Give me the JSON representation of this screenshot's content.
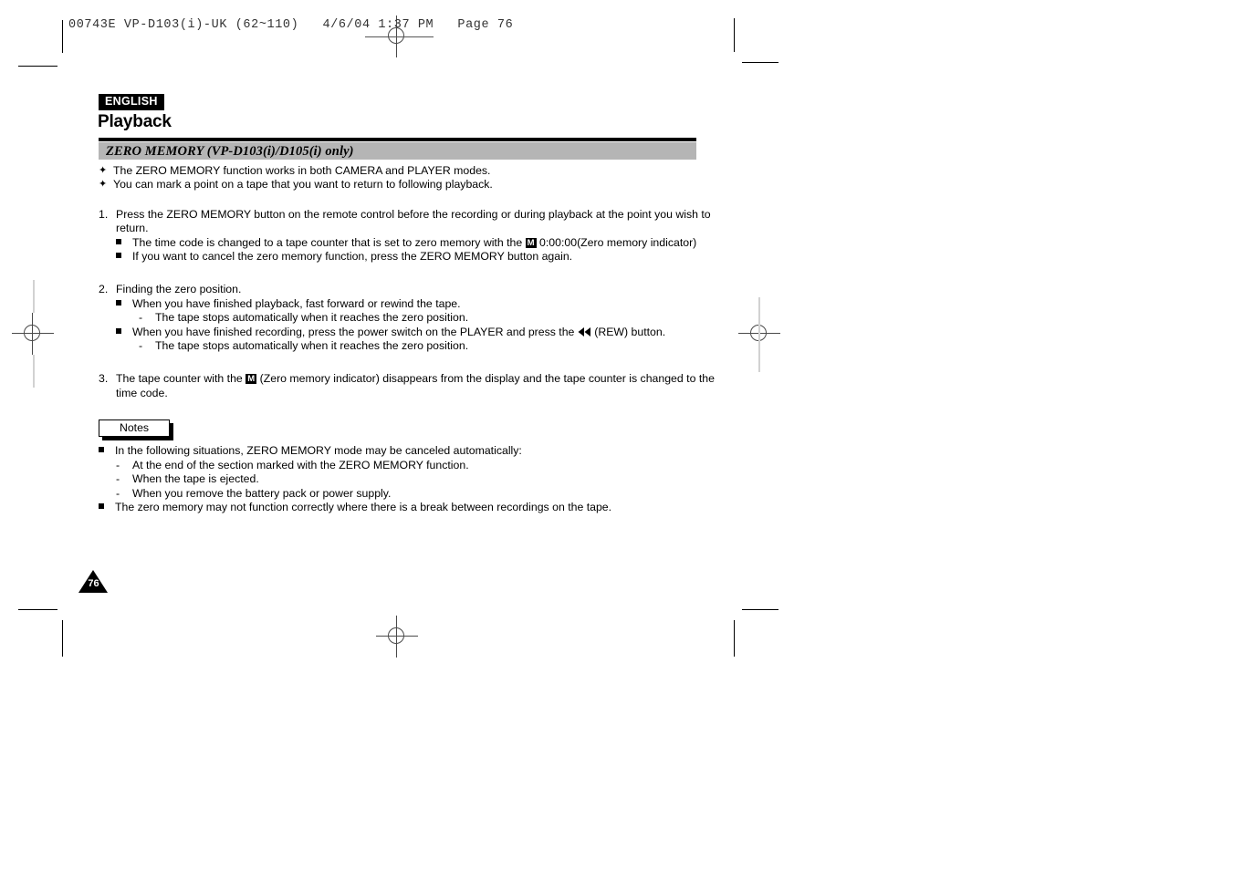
{
  "print_slug": {
    "text": "00743E VP-D103(i)-UK (62~110)   4/6/04 1:37 PM   Page 76"
  },
  "header": {
    "language_badge": "ENGLISH",
    "chapter_title": "Playback",
    "section_title": "ZERO MEMORY (VP-D103(i)/D105(i) only)"
  },
  "intro_bullets": [
    {
      "marker": "✦",
      "text": "The ZERO MEMORY function works in both CAMERA and PLAYER modes."
    },
    {
      "marker": "✦",
      "text": "You can mark a point on a tape that you want to return to following playback."
    }
  ],
  "steps": {
    "step1": {
      "number": "1.",
      "text": "Press the ZERO MEMORY button on the remote control before the recording or during playback at the point you wish to return.",
      "sub": [
        {
          "text_before": "The time code is changed to a tape counter that is set to zero memory with the",
          "icon": "M",
          "text_after": "0:00:00(Zero memory indicator)"
        },
        {
          "text_before": "If you want to cancel the zero memory function, press the ZERO MEMORY button again.",
          "icon": "",
          "text_after": ""
        }
      ]
    },
    "step2": {
      "number": "2.",
      "text": "Finding the zero position.",
      "sub1": "When you have finished playback, fast forward or rewind the tape.",
      "sub1_dash": "The tape stops automatically when it reaches the zero position.",
      "sub2_before": "When you have finished recording, press the power switch on the PLAYER and press the",
      "sub2_icon": "rewind-icon",
      "sub2_after": "(REW) button.",
      "sub2_dash": "The tape stops automatically when it reaches the zero position."
    },
    "step3": {
      "number": "3.",
      "text_before": "The tape counter with the",
      "icon": "M",
      "text_after": "(Zero memory indicator) disappears from the display and the tape counter is changed to the time code."
    }
  },
  "notes": {
    "label": "Notes",
    "items": [
      {
        "type": "square",
        "text": "In the following situations, ZERO MEMORY mode may be canceled automatically:"
      },
      {
        "type": "dash",
        "text": "At the end of the section marked with the ZERO MEMORY function."
      },
      {
        "type": "dash",
        "text": "When the tape is ejected."
      },
      {
        "type": "dash",
        "text": "When you remove the battery pack or power supply."
      },
      {
        "type": "square",
        "text": "The zero memory may not function correctly where there is a break between recordings on the tape."
      }
    ]
  },
  "page_number": "76",
  "colors": {
    "section_band": "#b5b5b5",
    "ink": "#000000",
    "reg_mark": "#4a4a4a"
  }
}
